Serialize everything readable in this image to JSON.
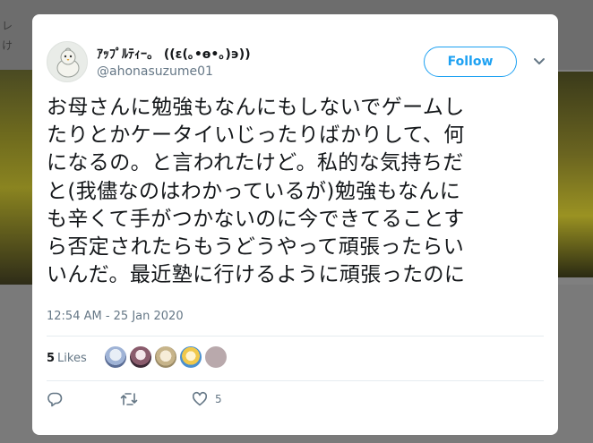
{
  "background": {
    "fragment_top": "レ",
    "fragment_second": "け"
  },
  "tweet": {
    "display_name": "ｱｯﾌﾟﾙﾃｨｰ。 ((ε(｡•ɵ•｡)϶))",
    "handle": "@ahonasuzume01",
    "follow_label": "Follow",
    "text_lines": [
      "お母さんに勉強もなんにもしないでゲームし",
      "たりとかケータイいじったりばかりして、何",
      "になるの。と言われたけど。私的な気持ちだ",
      "と(我儘なのはわかっているが)勉強もなんに",
      "も辛くて手がつかないのに今できてることす",
      "ら否定されたらもうどうやって頑張ったらい",
      "いんだ。最近塾に行けるように頑張ったのに"
    ],
    "timestamp": "12:54 AM - 25 Jan 2020",
    "likes_count": "5",
    "likes_label": "Likes",
    "like_action_count": "5"
  },
  "colors": {
    "accent": "#1da1f2",
    "text_primary": "#14171a",
    "text_secondary": "#657786"
  }
}
